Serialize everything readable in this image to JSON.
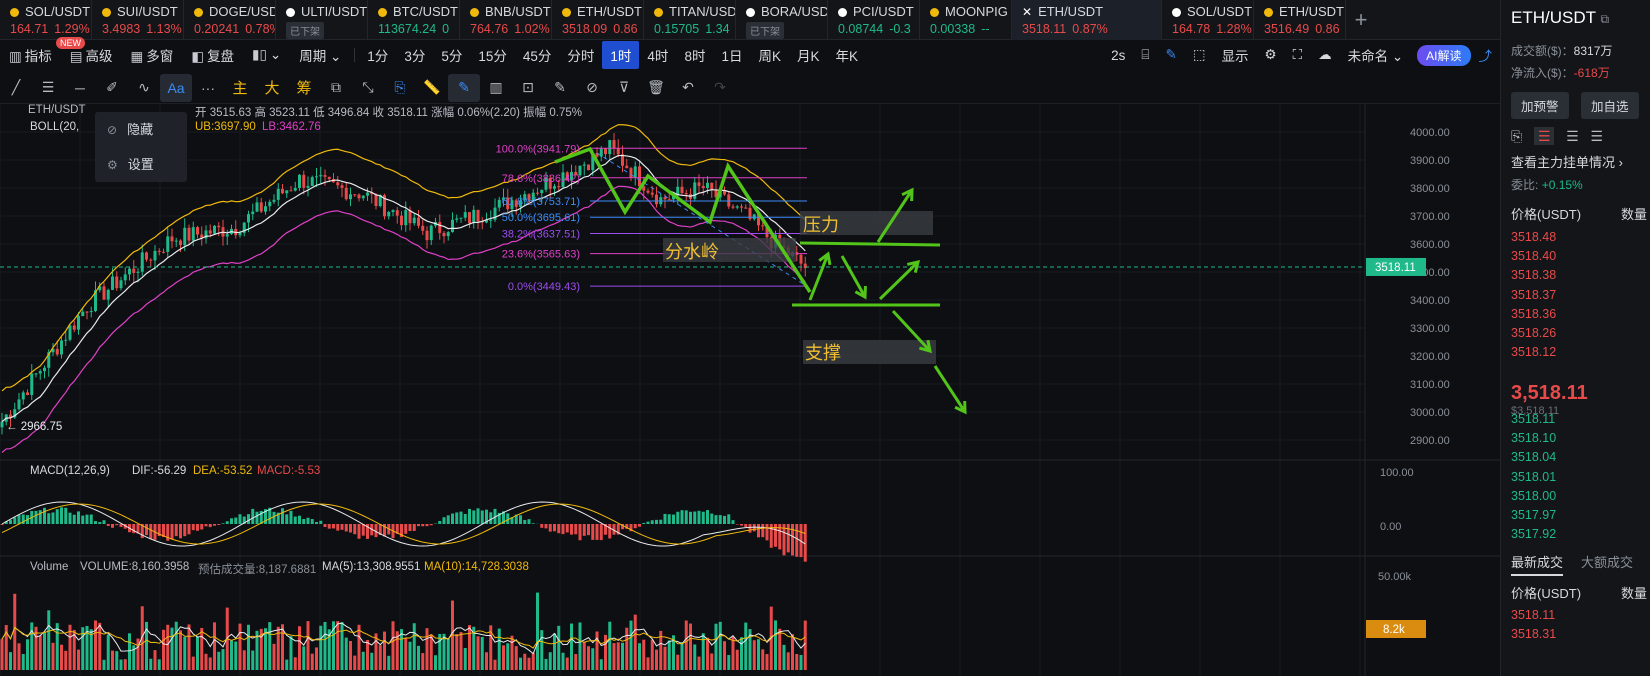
{
  "tabs": [
    {
      "symbol": "SOL/USDT",
      "price": "164.71",
      "change": "1.29%",
      "dir": "down",
      "dot": "#f0b90b"
    },
    {
      "symbol": "SUI/USDT",
      "price": "3.4983",
      "change": "1.13%",
      "dir": "down",
      "dot": "#f0b90b"
    },
    {
      "symbol": "DOGE/USDT",
      "price": "0.20241",
      "change": "0.78%",
      "dir": "down",
      "dot": "#f0b90b"
    },
    {
      "symbol": "ULTI/USDT",
      "price": "",
      "change": "",
      "dir": "delist",
      "dot": "#ffffff",
      "delist": "已下架"
    },
    {
      "symbol": "BTC/USDT",
      "price": "113674.24",
      "change": "0",
      "dir": "up",
      "dot": "#f0b90b"
    },
    {
      "symbol": "BNB/USDT",
      "price": "764.76",
      "change": "1.02%",
      "dir": "down",
      "dot": "#f0b90b"
    },
    {
      "symbol": "ETH/USDT",
      "price": "3518.09",
      "change": "0.86",
      "dir": "down",
      "dot": "#f0b90b"
    },
    {
      "symbol": "TITAN/USDT",
      "price": "0.15705",
      "change": "1.34",
      "dir": "up",
      "dot": "#f0b90b"
    },
    {
      "symbol": "BORA/USDT",
      "price": "",
      "change": "",
      "dir": "delist",
      "dot": "#ffffff",
      "delist": "已下架"
    },
    {
      "symbol": "PCI/USDT",
      "price": "0.08744",
      "change": "-0.3",
      "dir": "up",
      "dot": "#ffffff"
    },
    {
      "symbol": "MOONPIG",
      "price": "0.00338",
      "change": "--",
      "dir": "up",
      "dot": "#f0b90b"
    },
    {
      "symbol": "ETH/USDT",
      "price": "3518.11",
      "change": "0.87%",
      "dir": "down",
      "dot": "#ffffff",
      "active": true
    },
    {
      "symbol": "SOL/USDT",
      "price": "164.78",
      "change": "1.28%",
      "dir": "down",
      "dot": "#ffffff"
    },
    {
      "symbol": "ETH/USDT",
      "price": "3516.49",
      "change": "0.86",
      "dir": "down",
      "dot": "#f0b90b"
    }
  ],
  "toolbar": {
    "indicators": "指标",
    "new_badge": "NEW",
    "advanced": "高级",
    "multi_window": "多窗",
    "replay": "复盘",
    "period": "周期",
    "intervals": [
      "1分",
      "3分",
      "5分",
      "15分",
      "45分",
      "分时",
      "1时",
      "4时",
      "8时",
      "1日",
      "周K",
      "月K",
      "年K"
    ],
    "selected_interval": "1时",
    "right_2s": "2s",
    "display": "显示",
    "unnamed": "未命名",
    "ai": "AI解读"
  },
  "drawing_tools": {
    "main": "主",
    "big": "大",
    "chips": "筹",
    "font": "Aa"
  },
  "legend": {
    "symbol": "ETH/USDT",
    "ohlc": "开 3515.63  高 3523.11  低 3496.84  收 3518.11  涨幅 0.06%(2.20)  振幅 0.75%",
    "boll": "BOLL(20,",
    "ub": "UB:3697.90",
    "lb": "LB:3462.76",
    "macd_name": "MACD(12,26,9)",
    "dif": "DIF:-56.29",
    "dea": "DEA:-53.52",
    "macd": "MACD:-5.53",
    "vol_name": "Volume",
    "vol_value": "VOLUME:8,160.3958",
    "vol_est": "预估成交量:8,187.6881",
    "ma5": "MA(5):13,308.9551",
    "ma10": "MA(10):14,728.3038"
  },
  "context_menu": {
    "hide": "隐藏",
    "settings": "设置"
  },
  "fib": [
    {
      "label": "100.0%(3941.79)",
      "color": "#e040c8"
    },
    {
      "label": "78.6%(3836.42)",
      "color": "#e040c8"
    },
    {
      "label": "61.8%(3753.71)",
      "color": "#3b8cf6"
    },
    {
      "label": "50.0%(3695.61)",
      "color": "#3b8cf6"
    },
    {
      "label": "38.2%(3637.51)",
      "color": "#9c4cf0"
    },
    {
      "label": "23.6%(3565.63)",
      "color": "#e040c8"
    },
    {
      "label": "0.0%(3449.43)",
      "color": "#9c4cf0"
    }
  ],
  "annotations": {
    "pressure": "压力",
    "watershed": "分水岭",
    "support": "支撑",
    "low_mark": "2966.75"
  },
  "price_axis": {
    "ticks": [
      "4000.00",
      "3900.00",
      "3800.00",
      "3700.00",
      "3600.00",
      "3500.00",
      "3400.00",
      "3300.00",
      "3200.00",
      "3100.00",
      "3000.00",
      "2900.00"
    ],
    "current": "3518.11",
    "macd_ticks": [
      "100.00",
      "0.00"
    ],
    "vol_ticks": [
      "50.00k"
    ],
    "vol_current": "8.2k"
  },
  "right_panel": {
    "title": "ETH/USDT",
    "turnover_label": "成交额($)：",
    "turnover": "8317万",
    "netflow_label": "净流入($)：",
    "netflow": "-618万",
    "alert_btn": "加预警",
    "fav_btn": "加自选",
    "main_orders": "查看主力挂单情况",
    "ratio_label": "委比:",
    "ratio": "+0.15%",
    "col_price": "价格(USDT)",
    "col_qty": "数量",
    "asks": [
      "3518.48",
      "3518.40",
      "3518.38",
      "3518.37",
      "3518.36",
      "3518.26",
      "3518.12"
    ],
    "last_price": "3,518.11",
    "last_usd": "$3,518.11",
    "bids": [
      "3518.11",
      "3518.10",
      "3518.04",
      "3518.01",
      "3518.00",
      "3517.97",
      "3517.92"
    ],
    "trades_tab": "最新成交",
    "big_trades_tab": "大额成交",
    "trades": [
      "3518.11",
      "3518.31"
    ]
  }
}
